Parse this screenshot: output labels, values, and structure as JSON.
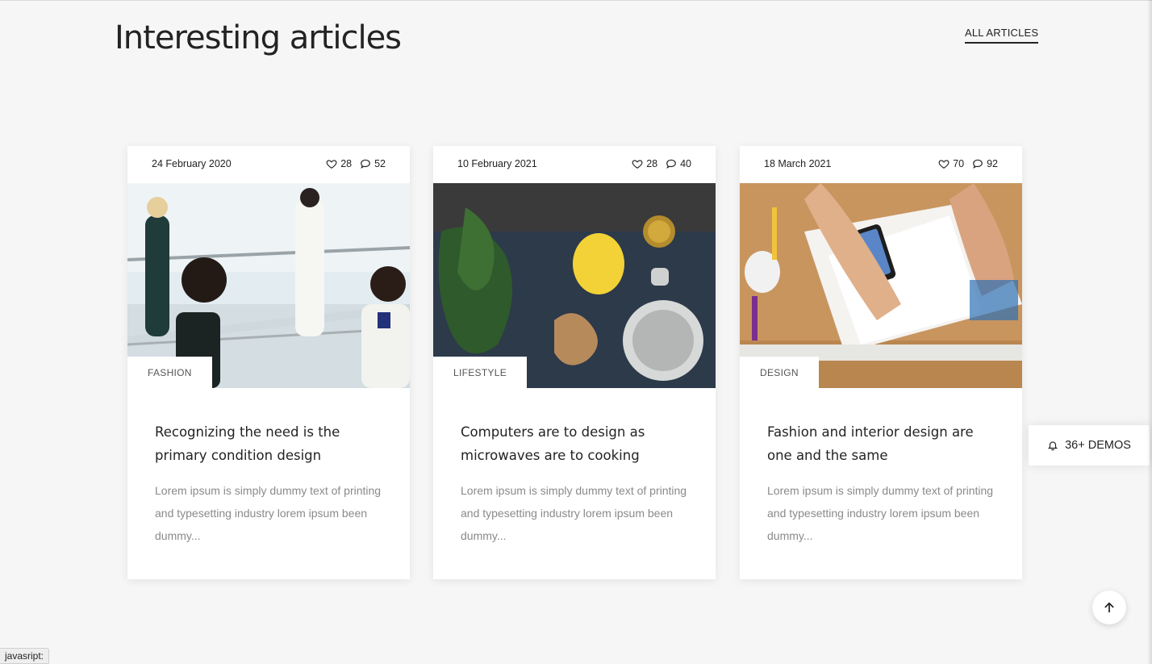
{
  "section": {
    "title": "Interesting articles",
    "all_link": "ALL ARTICLES"
  },
  "articles": [
    {
      "date": "24 February 2020",
      "likes": "28",
      "comments": "52",
      "category": "FASHION",
      "title": "Recognizing the need is the primary condition design",
      "excerpt": "Lorem ipsum is simply dummy text of printing and typesetting industry lorem ipsum been dummy..."
    },
    {
      "date": "10 February 2021",
      "likes": "28",
      "comments": "40",
      "category": "LIFESTYLE",
      "title": "Computers are to design as microwaves are to cooking",
      "excerpt": "Lorem ipsum is simply dummy text of printing and typesetting industry lorem ipsum been dummy..."
    },
    {
      "date": "18 March 2021",
      "likes": "70",
      "comments": "92",
      "category": "DESIGN",
      "title": "Fashion and interior design are one and the same",
      "excerpt": "Lorem ipsum is simply dummy text of printing and typesetting industry lorem ipsum been dummy..."
    }
  ],
  "floating": {
    "demos_label": "36+ DEMOS"
  },
  "status_bar": {
    "text": "javasript:"
  },
  "icons": {
    "like": "heart-icon",
    "comment": "comment-icon",
    "demos": "bell-icon",
    "scroll_top": "arrow-up-icon"
  },
  "colors": {
    "background": "#f6f6f6",
    "card": "#ffffff",
    "text": "#232323",
    "muted": "#8a8a8a"
  }
}
